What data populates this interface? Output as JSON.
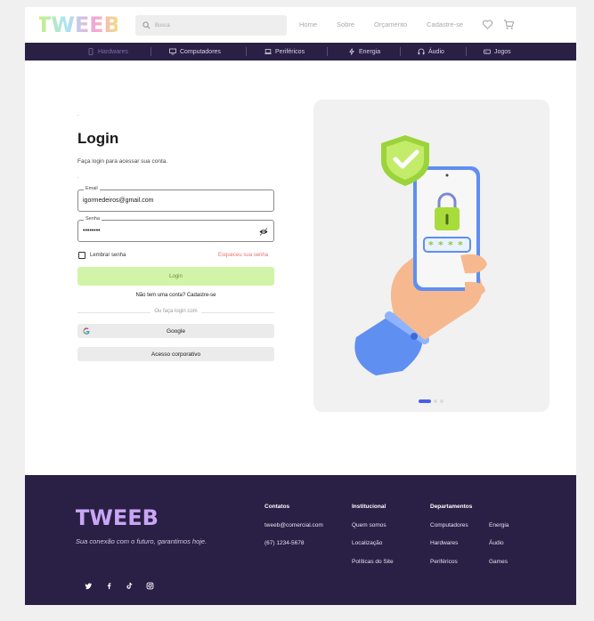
{
  "header": {
    "logo_text": "TWEEB",
    "search_placeholder": "Busca",
    "nav": [
      "Home",
      "Sobre",
      "Orçamento",
      "Cadastre-se"
    ]
  },
  "categories": [
    {
      "label": "Hardwares",
      "icon": "phone-icon"
    },
    {
      "label": "Computadores",
      "icon": "monitor-icon"
    },
    {
      "label": "Periféricos",
      "icon": "laptop-icon"
    },
    {
      "label": "Energia",
      "icon": "bolt-icon"
    },
    {
      "label": "Áudio",
      "icon": "headphones-icon"
    },
    {
      "label": "Jogos",
      "icon": "gamepad-icon"
    }
  ],
  "login": {
    "title": "Login",
    "subtitle": "Faça login para acessar sua conta.",
    "email_label": "Email",
    "email_value": "igormedeiros@gmail.com",
    "password_label": "Senha",
    "password_value": "••••••••",
    "remember_label": "Lembrar senha",
    "forgot_label": "Esqueceu sua senha",
    "login_button": "Login",
    "signup_text": "Não tem uma conta? Cadastre-se",
    "divider_text": "Ou faça login com",
    "google_button": "Google",
    "corporate_button": "Acesso corporativo"
  },
  "footer": {
    "logo_text": "TWEEB",
    "slogan": "Sua conexão com o futuro, garantimos hoje.",
    "contacts": {
      "title": "Contatos",
      "items": [
        "tweeb@comercial.com",
        "(67) 1234-5678"
      ]
    },
    "institutional": {
      "title": "Institucional",
      "items": [
        "Quem somos",
        "Localização",
        "Políticas do Site"
      ]
    },
    "departments": {
      "title": "Departamentos",
      "col1": [
        "Computadores",
        "Hardwares",
        "Periféricos"
      ],
      "col2": [
        "Energia",
        "Áudio",
        "Games"
      ]
    }
  },
  "colors": {
    "brand_dark": "#2a1f45",
    "accent_green": "#d2f4a8",
    "forgot_red": "#e8706a",
    "pager_blue": "#4d5ce6"
  }
}
